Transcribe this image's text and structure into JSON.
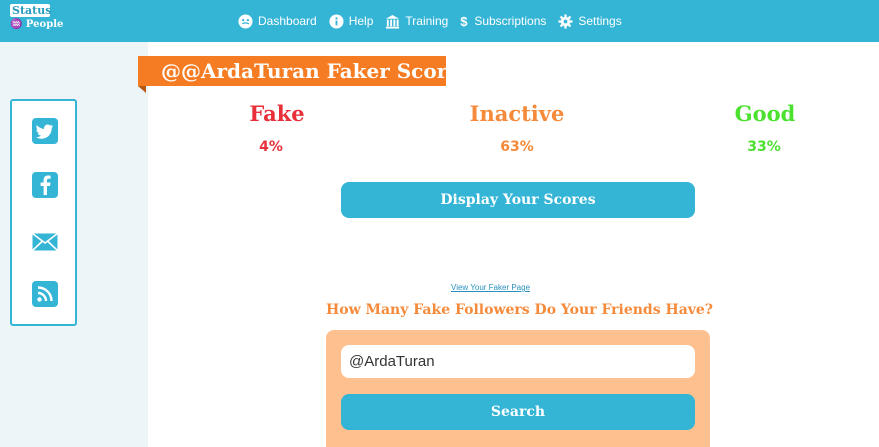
{
  "logo": {
    "line1": "Status",
    "line2": "♒ People"
  },
  "nav": [
    {
      "label": "Dashboard",
      "icon": "dashboard-icon"
    },
    {
      "label": "Help",
      "icon": "info-icon"
    },
    {
      "label": "Training",
      "icon": "building-icon"
    },
    {
      "label": "Subscriptions",
      "icon": "dollar-icon"
    },
    {
      "label": "Settings",
      "icon": "gear-icon"
    }
  ],
  "social": [
    {
      "icon": "twitter-icon"
    },
    {
      "icon": "facebook-icon"
    },
    {
      "icon": "email-icon"
    },
    {
      "icon": "rss-icon"
    }
  ],
  "heading": "@@ArdaTuran Faker Scores",
  "scores": {
    "fake": {
      "label": "Fake",
      "value": "4%"
    },
    "inactive": {
      "label": "Inactive",
      "value": "63%"
    },
    "good": {
      "label": "Good",
      "value": "33%"
    }
  },
  "display_button": "Display Your Scores",
  "faker_link": "View Your Faker Page",
  "question": "How Many Fake Followers Do Your Friends Have?",
  "search": {
    "value": "@ArdaTuran",
    "button": "Search"
  },
  "colors": {
    "primary": "#35b5d6",
    "orange": "#f57c22",
    "fake": "#e8303a",
    "inactive": "#f58a3a",
    "good": "#4ce12f",
    "form_bg": "#fec08e"
  }
}
